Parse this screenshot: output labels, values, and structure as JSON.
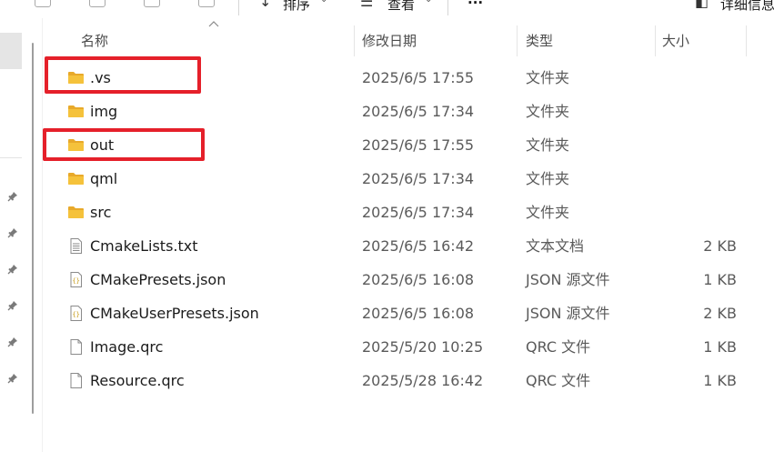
{
  "toolbar": {
    "sort_label": "排序",
    "view_label": "查看",
    "more_label": "···",
    "details_label": "详细信息"
  },
  "columns": {
    "name": "名称",
    "modified": "修改日期",
    "type": "类型",
    "size": "大小"
  },
  "files": [
    {
      "name": ".vs",
      "modified": "2025/6/5 17:55",
      "type": "文件夹",
      "size": "",
      "icon": "folder-icon"
    },
    {
      "name": "img",
      "modified": "2025/6/5 17:34",
      "type": "文件夹",
      "size": "",
      "icon": "folder-icon"
    },
    {
      "name": "out",
      "modified": "2025/6/5 17:55",
      "type": "文件夹",
      "size": "",
      "icon": "folder-icon"
    },
    {
      "name": "qml",
      "modified": "2025/6/5 17:34",
      "type": "文件夹",
      "size": "",
      "icon": "folder-icon"
    },
    {
      "name": "src",
      "modified": "2025/6/5 17:34",
      "type": "文件夹",
      "size": "",
      "icon": "folder-icon"
    },
    {
      "name": "CmakeLists.txt",
      "modified": "2025/6/5 16:42",
      "type": "文本文档",
      "size": "2 KB",
      "icon": "text-file-icon"
    },
    {
      "name": "CMakePresets.json",
      "modified": "2025/6/5 16:08",
      "type": "JSON 源文件",
      "size": "1 KB",
      "icon": "json-file-icon"
    },
    {
      "name": "CMakeUserPresets.json",
      "modified": "2025/6/5 16:08",
      "type": "JSON 源文件",
      "size": "2 KB",
      "icon": "json-file-icon"
    },
    {
      "name": "Image.qrc",
      "modified": "2025/5/20 10:25",
      "type": "QRC 文件",
      "size": "1 KB",
      "icon": "blank-file-icon"
    },
    {
      "name": "Resource.qrc",
      "modified": "2025/5/28 16:42",
      "type": "QRC 文件",
      "size": "1 KB",
      "icon": "blank-file-icon"
    }
  ],
  "colors": {
    "folder": "#f5c23b",
    "highlight_box": "#e5202a",
    "header_text": "#4c4c4c"
  }
}
